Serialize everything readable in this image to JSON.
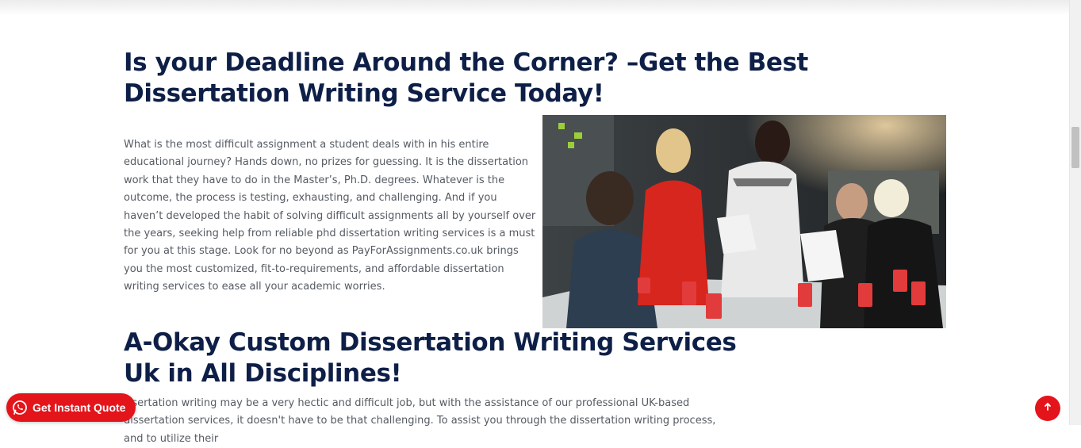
{
  "section1": {
    "heading": "Is your Deadline Around the Corner? –Get the Best Dissertation Writing Service Today!",
    "paragraph": "What is the most difficult assignment a student deals with in his entire educational journey? Hands down, no prizes for guessing. It is the dissertation work that they have to do in the Master’s, Ph.D. degrees. Whatever is the outcome, the process is testing, exhausting, and challenging. And if you haven’t developed the habit of solving difficult assignments all by yourself over the years, seeking help from reliable phd dissertation writing services is a must for you at this stage. Look for no beyond as PayForAssignments.co.uk brings you the most customized, fit-to-requirements, and affordable dissertation writing services to ease all your academic worries."
  },
  "section2": {
    "heading": "A-Okay Custom Dissertation Writing Services Uk in All Disciplines!",
    "paragraph": "issertation writing may be a very hectic and difficult job, but with the assistance of our professional UK-based dissertation services, it doesn't have to be that challenging. To assist you through the dissertation writing process, and to utilize their"
  },
  "floating": {
    "quote_label": "Get Instant Quote",
    "quote_icon": "whatsapp-icon",
    "top_icon": "arrow-up-icon"
  },
  "colors": {
    "heading": "#0e1f47",
    "accent": "#e4141b",
    "body_text": "#555b63"
  }
}
